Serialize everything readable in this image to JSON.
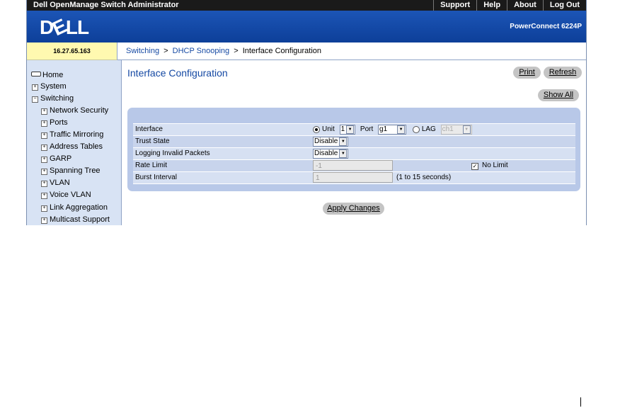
{
  "topbar": {
    "title": "Dell OpenManage Switch Administrator",
    "links": [
      "Support",
      "Help",
      "About",
      "Log Out"
    ]
  },
  "banner": {
    "logo": "D",
    "logo_e": "E",
    "logo_rest": "LL",
    "model": "PowerConnect 6224P"
  },
  "ip": "16.27.65.163",
  "breadcrumb": {
    "part1": "Switching",
    "sep1": ">",
    "part2": "DHCP Snooping",
    "sep2": ">",
    "current": "Interface Configuration"
  },
  "nav": {
    "home": "Home",
    "system": "System",
    "switching": "Switching",
    "sub": [
      "Network Security",
      "Ports",
      "Traffic Mirroring",
      "Address Tables",
      "GARP",
      "Spanning Tree",
      "VLAN",
      "Voice VLAN",
      "Link Aggregation",
      "Multicast Support"
    ],
    "plus": "+",
    "minus": "−"
  },
  "page": {
    "title": "Interface Configuration",
    "print": "Print",
    "refresh": "Refresh",
    "show_all": "Show All",
    "apply": "Apply Changes"
  },
  "form": {
    "interface_label": "Interface",
    "unit_label": "Unit",
    "unit_value": "1",
    "port_label": "Port",
    "port_value": "g1",
    "lag_label": "LAG",
    "lag_value": "ch1",
    "trust_label": "Trust State",
    "trust_value": "Disable",
    "logging_label": "Logging Invalid Packets",
    "logging_value": "Disable",
    "rate_label": "Rate Limit",
    "rate_value": "-1",
    "no_limit_label": "No Limit",
    "no_limit_checked": true,
    "burst_label": "Burst Interval",
    "burst_value": "1",
    "burst_hint": "(1 to 15 seconds)",
    "arrow": "▼",
    "check": "✓"
  }
}
